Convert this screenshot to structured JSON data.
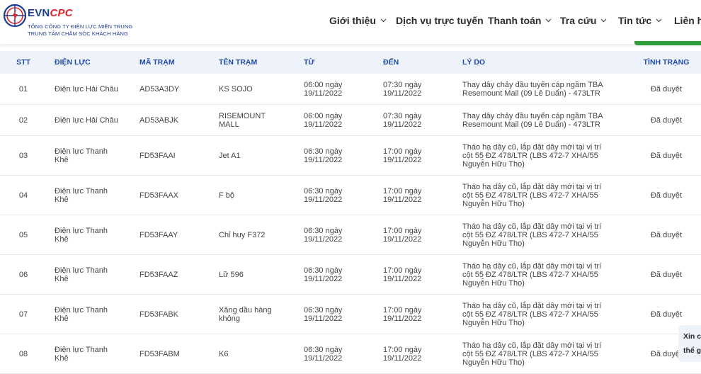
{
  "brand": {
    "part1": "EVN",
    "part2": "CPC",
    "line1": "TỔNG CÔNG TY ĐIỆN LỰC MIỀN TRUNG",
    "line2": "TRUNG TÂM CHĂM SÓC KHÁCH HÀNG"
  },
  "nav": {
    "items": [
      {
        "label": "Giới thiệu"
      },
      {
        "label": "Dịch vụ trực tuyến"
      },
      {
        "label": "Thanh toán"
      },
      {
        "label": "Tra cứu"
      },
      {
        "label": "Tin tức"
      },
      {
        "label": "Liên hệ"
      }
    ]
  },
  "table": {
    "headers": [
      "STT",
      "ĐIỆN LỰC",
      "MÃ TRẠM",
      "TÊN TRẠM",
      "TỪ",
      "ĐẾN",
      "LÝ DO",
      "TÌNH TRẠNG"
    ],
    "rows": [
      {
        "stt": "01",
        "dien_luc": "Điện lực Hải Châu",
        "ma_tram": "AD53A3DY",
        "ten_tram": "KS SOJO",
        "tu": "06:00 ngày 19/11/2022",
        "den": "07:30 ngày 19/11/2022",
        "ly_do": "Thay dây chảy đầu tuyến cáp ngầm TBA Resemount Mail (09 Lê Duẩn) - 473LTR",
        "tinh_trang": "Đã duyệt"
      },
      {
        "stt": "02",
        "dien_luc": "Điện lực Hải Châu",
        "ma_tram": "AD53ABJK",
        "ten_tram": "RISEMOUNT MALL",
        "tu": "06:00 ngày 19/11/2022",
        "den": "07:30 ngày 19/11/2022",
        "ly_do": "Thay dây chảy đầu tuyến cáp ngầm TBA Resemount Mail (09 Lê Duẩn) - 473LTR",
        "tinh_trang": "Đã duyệt"
      },
      {
        "stt": "03",
        "dien_luc": "Điện lực Thanh Khê",
        "ma_tram": "FD53FAAI",
        "ten_tram": "Jet A1",
        "tu": "06:30 ngày 19/11/2022",
        "den": "17:00 ngày 19/11/2022",
        "ly_do": "Tháo hạ dây cũ, lắp đặt dây mới tại vị trí cột 55 ĐZ 478/LTR (LBS 472-7 XHA/55 Nguyễn Hữu Thọ)",
        "tinh_trang": "Đã duyệt"
      },
      {
        "stt": "04",
        "dien_luc": "Điện lực Thanh Khê",
        "ma_tram": "FD53FAAX",
        "ten_tram": "F bộ",
        "tu": "06:30 ngày 19/11/2022",
        "den": "17:00 ngày 19/11/2022",
        "ly_do": "Tháo hạ dây cũ, lắp đặt dây mới tại vị trí cột 55 ĐZ 478/LTR (LBS 472-7 XHA/55 Nguyễn Hữu Thọ)",
        "tinh_trang": "Đã duyệt"
      },
      {
        "stt": "05",
        "dien_luc": "Điện lực Thanh Khê",
        "ma_tram": "FD53FAAY",
        "ten_tram": "Chỉ huy F372",
        "tu": "06:30 ngày 19/11/2022",
        "den": "17:00 ngày 19/11/2022",
        "ly_do": "Tháo hạ dây cũ, lắp đặt dây mới tại vị trí cột 55 ĐZ 478/LTR (LBS 472-7 XHA/55 Nguyễn Hữu Thọ)",
        "tinh_trang": "Đã duyệt"
      },
      {
        "stt": "06",
        "dien_luc": "Điện lực Thanh Khê",
        "ma_tram": "FD53FAAZ",
        "ten_tram": "Lữ 596",
        "tu": "06:30 ngày 19/11/2022",
        "den": "17:00 ngày 19/11/2022",
        "ly_do": "Tháo hạ dây cũ, lắp đặt dây mới tại vị trí cột 55 ĐZ 478/LTR (LBS 472-7 XHA/55 Nguyễn Hữu Thọ)",
        "tinh_trang": "Đã duyệt"
      },
      {
        "stt": "07",
        "dien_luc": "Điện lực Thanh Khê",
        "ma_tram": "FD53FABK",
        "ten_tram": "Xăng dầu hàng không",
        "tu": "06:30 ngày 19/11/2022",
        "den": "17:00 ngày 19/11/2022",
        "ly_do": "Tháo hạ dây cũ, lắp đặt dây mới tại vị trí cột 55 ĐZ 478/LTR (LBS 472-7 XHA/55 Nguyễn Hữu Thọ)",
        "tinh_trang": "Đã duyệt"
      },
      {
        "stt": "08",
        "dien_luc": "Điện lực Thanh Khê",
        "ma_tram": "FD53FABM",
        "ten_tram": "K6",
        "tu": "06:30 ngày 19/11/2022",
        "den": "17:00 ngày 19/11/2022",
        "ly_do": "Tháo hạ dây cũ, lắp đặt dây mới tại vị trí cột 55 ĐZ 478/LTR (LBS 472-7 XHA/55 Nguyễn Hữu Thọ)",
        "tinh_trang": "Đã duyệt"
      }
    ]
  },
  "chat": {
    "line1": "Xin c",
    "line2": "thể g"
  },
  "colors": {
    "brand_blue": "#1a3d8f",
    "brand_red": "#e0242b",
    "header_blue": "#1f4aa8",
    "accent_green": "#2f9e3a"
  }
}
